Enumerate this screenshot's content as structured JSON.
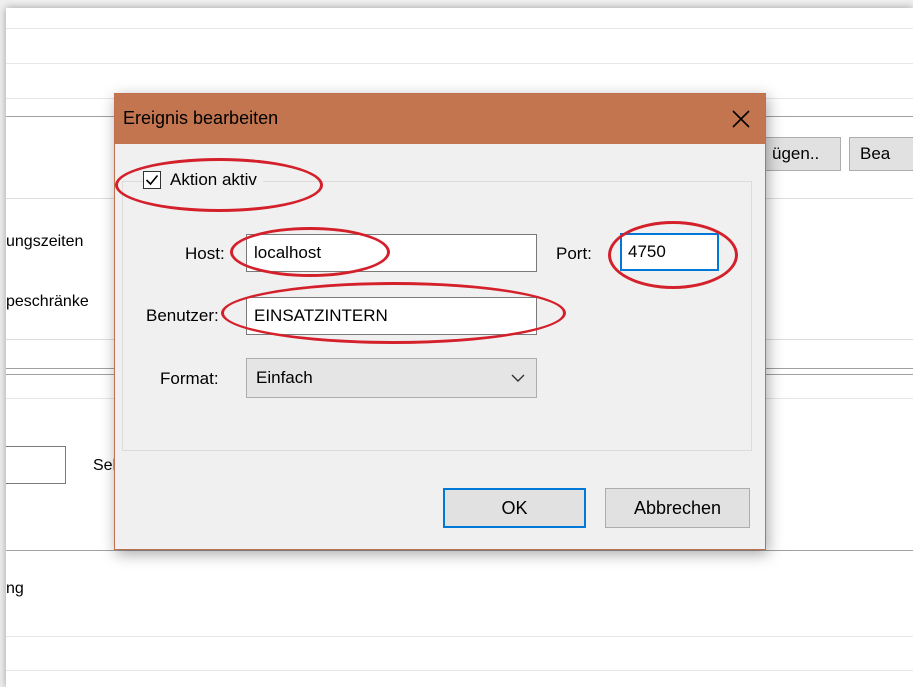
{
  "background": {
    "button_fuegen": "ügen..",
    "button_bea": "Bea",
    "text_ungszeiten": "ungszeiten",
    "text_beschraenke": "peschränke",
    "text_sek": "Sek",
    "text_ng": "ng"
  },
  "dialog": {
    "title": "Ereignis bearbeiten",
    "close_glyph": "✕",
    "action_checkbox": {
      "label": "Aktion aktiv",
      "checked": true
    },
    "host": {
      "label": "Host:",
      "value": "localhost"
    },
    "port": {
      "label": "Port:",
      "value": "4750"
    },
    "user": {
      "label": "Benutzer:",
      "value": "EINSATZINTERN"
    },
    "format": {
      "label": "Format:",
      "value": "Einfach"
    },
    "ok_label": "OK",
    "cancel_label": "Abbrechen"
  },
  "colors": {
    "titlebar": "#c3754f",
    "annotation": "#d4202a",
    "focus": "#0078d7"
  }
}
